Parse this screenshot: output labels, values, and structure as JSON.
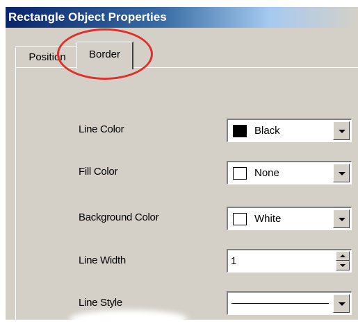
{
  "window": {
    "title": "Rectangle Object Properties"
  },
  "tabs": [
    {
      "label": "Position",
      "active": false
    },
    {
      "label": "Border",
      "active": true
    }
  ],
  "properties": {
    "line_color": {
      "label": "Line Color",
      "value": "Black",
      "swatch": "#000000"
    },
    "fill_color": {
      "label": "Fill Color",
      "value": "None",
      "swatch": "#ffffff"
    },
    "background_color": {
      "label": "Background Color",
      "value": "White",
      "swatch": "#ffffff"
    },
    "line_width": {
      "label": "Line Width",
      "value": "1"
    },
    "line_style": {
      "label": "Line Style",
      "value_icon": "solid-line"
    }
  },
  "colors": {
    "annotation": "#e0302a",
    "titlebar": "#0a246a",
    "dialog_face": "#d4d0c8"
  }
}
